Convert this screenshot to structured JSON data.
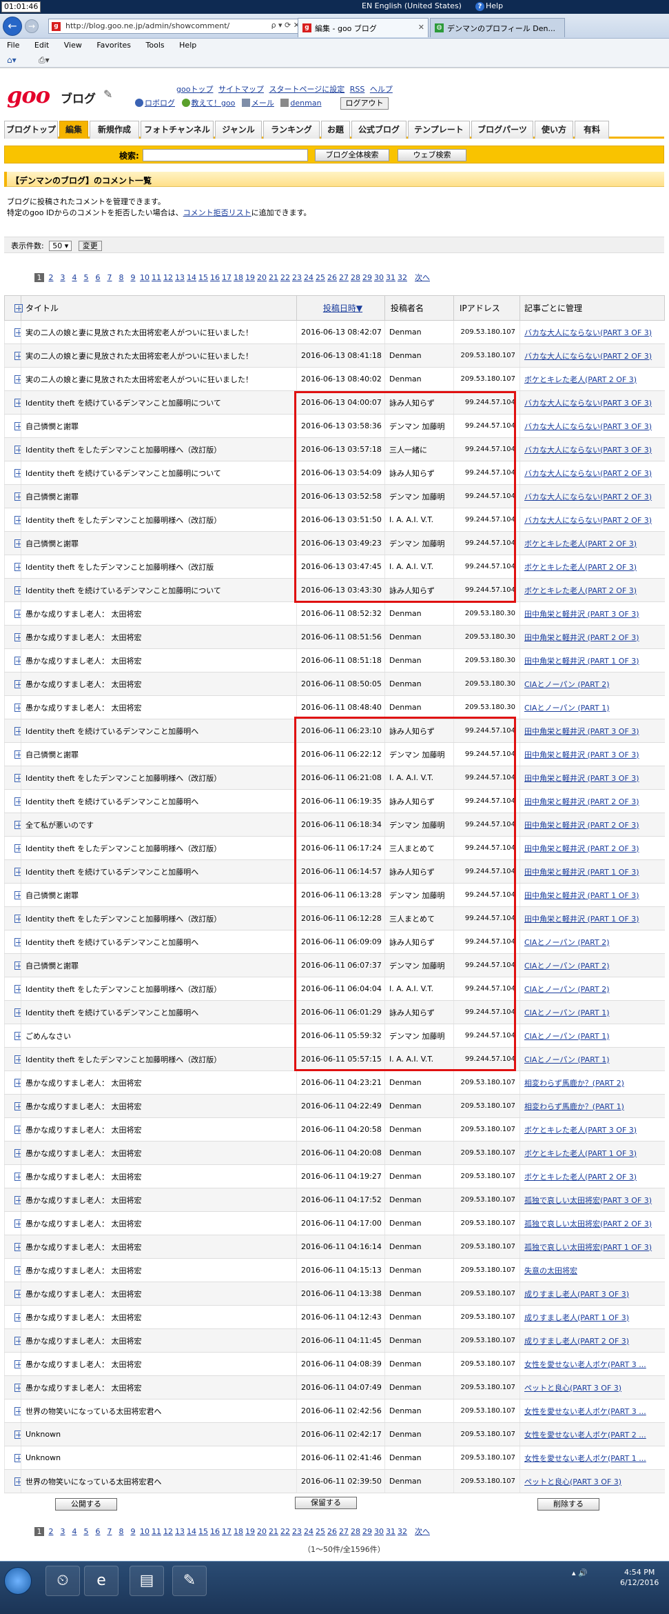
{
  "system": {
    "clock": "01:01:46",
    "language": "EN English (United States)",
    "help": "Help"
  },
  "browser": {
    "url": "http://blog.goo.ne.jp/admin/showcomment/",
    "address_tools": "ρ ▾ ⟳ ✕",
    "tabs": [
      "編集 - goo ブログ",
      "デンマンのプロフィール Den..."
    ],
    "menu": [
      "File",
      "Edit",
      "View",
      "Favorites",
      "Tools",
      "Help"
    ]
  },
  "site": {
    "logo": "goo",
    "blog_word": "ブログ",
    "top_links": [
      "gooトップ",
      "サイトマップ",
      "スタートページに設定",
      "RSS",
      "ヘルプ"
    ],
    "user_links": [
      "ロボログ",
      "教えて！goo",
      "メール",
      "denman"
    ],
    "logout": "ログアウト",
    "nav": [
      "ブログトップ",
      "編集",
      "新規作成",
      "フォトチャンネル",
      "ジャンル",
      "ランキング",
      "お題",
      "公式ブログ",
      "テンプレート",
      "ブログパーツ",
      "使い方",
      "有料"
    ],
    "search_label": "検索:",
    "search_blog_btn": "ブログ全体検索",
    "search_web_btn": "ウェブ検索"
  },
  "section": {
    "title": "【デンマンのブログ】のコメント一覧",
    "desc1": "ブログに投稿されたコメントを管理できます。",
    "desc2_prefix": "特定のgoo IDからのコメントを拒否したい場合は、",
    "desc2_link": "コメント拒否リスト",
    "desc2_suffix": "に追加できます。",
    "show_label": "表示件数:",
    "show_value": "50 ▾",
    "change_btn": "変更"
  },
  "pager": {
    "pages": [
      "1",
      "2",
      "3",
      "4",
      "5",
      "6",
      "7",
      "8",
      "9",
      "10",
      "11",
      "12",
      "13",
      "14",
      "15",
      "16",
      "17",
      "18",
      "19",
      "20",
      "21",
      "22",
      "23",
      "24",
      "25",
      "26",
      "27",
      "28",
      "29",
      "30",
      "31",
      "32"
    ],
    "next": "次へ"
  },
  "table": {
    "headers": {
      "title": "タイトル",
      "date": "投稿日時▼",
      "name": "投稿者名",
      "ip": "IPアドレス",
      "article": "記事ごとに管理"
    },
    "rows": [
      {
        "t": "実の二人の娘と妻に見放された太田将宏老人がついに狂いました！",
        "d": "2016-06-13 08:42:07",
        "n": "Denman",
        "ip": "209.53.180.107",
        "a": "バカな大人にならない(PART 3 OF 3)"
      },
      {
        "t": "実の二人の娘と妻に見放された太田将宏老人がついに狂いました！",
        "d": "2016-06-13 08:41:18",
        "n": "Denman",
        "ip": "209.53.180.107",
        "a": "バカな大人にならない(PART 2 OF 3)"
      },
      {
        "t": "実の二人の娘と妻に見放された太田将宏老人がついに狂いました！",
        "d": "2016-06-13 08:40:02",
        "n": "Denman",
        "ip": "209.53.180.107",
        "a": "ボケとキレた老人(PART 2 OF 3)"
      },
      {
        "t": "Identity theft を続けているデンマンこと加藤明について",
        "d": "2016-06-13 04:00:07",
        "n": "詠み人知らず",
        "ip": "99.244.57.104",
        "a": "バカな大人にならない(PART 3 OF 3)"
      },
      {
        "t": "自己憐憫と謝罪",
        "d": "2016-06-13 03:58:36",
        "n": "デンマン 加藤明",
        "ip": "99.244.57.104",
        "a": "バカな大人にならない(PART 3 OF 3)"
      },
      {
        "t": "Identity theft をしたデンマンこと加藤明様へ（改訂版）",
        "d": "2016-06-13 03:57:18",
        "n": "三人一緒に",
        "ip": "99.244.57.104",
        "a": "バカな大人にならない(PART 3 OF 3)"
      },
      {
        "t": "Identity theft を続けているデンマンこと加藤明について",
        "d": "2016-06-13 03:54:09",
        "n": "詠み人知らず",
        "ip": "99.244.57.104",
        "a": "バカな大人にならない(PART 2 OF 3)"
      },
      {
        "t": "自己憐憫と謝罪",
        "d": "2016-06-13 03:52:58",
        "n": "デンマン 加藤明",
        "ip": "99.244.57.104",
        "a": "バカな大人にならない(PART 2 OF 3)"
      },
      {
        "t": "Identity theft をしたデンマンこと加藤明様へ（改訂版）",
        "d": "2016-06-13 03:51:50",
        "n": "I. A. A.I. V.T.",
        "ip": "99.244.57.104",
        "a": "バカな大人にならない(PART 2 OF 3)"
      },
      {
        "t": "自己憐憫と謝罪",
        "d": "2016-06-13 03:49:23",
        "n": "デンマン 加藤明",
        "ip": "99.244.57.104",
        "a": "ボケとキレた老人(PART 2 OF 3)"
      },
      {
        "t": "Identity theft をしたデンマンこと加藤明様へ（改訂版",
        "d": "2016-06-13 03:47:45",
        "n": "I. A. A.I. V.T.",
        "ip": "99.244.57.104",
        "a": "ボケとキレた老人(PART 2 OF 3)"
      },
      {
        "t": "Identity theft を続けているデンマンこと加藤明について",
        "d": "2016-06-13 03:43:30",
        "n": "詠み人知らず",
        "ip": "99.244.57.104",
        "a": "ボケとキレた老人(PART 2 OF 3)"
      },
      {
        "t": "愚かな成りすまし老人： 太田将宏",
        "d": "2016-06-11 08:52:32",
        "n": "Denman",
        "ip": "209.53.180.30",
        "a": "田中角栄と軽井沢 (PART 3 OF 3)"
      },
      {
        "t": "愚かな成りすまし老人： 太田将宏",
        "d": "2016-06-11 08:51:56",
        "n": "Denman",
        "ip": "209.53.180.30",
        "a": "田中角栄と軽井沢 (PART 2 OF 3)"
      },
      {
        "t": "愚かな成りすまし老人： 太田将宏",
        "d": "2016-06-11 08:51:18",
        "n": "Denman",
        "ip": "209.53.180.30",
        "a": "田中角栄と軽井沢 (PART 1 OF 3)"
      },
      {
        "t": "愚かな成りすまし老人： 太田将宏",
        "d": "2016-06-11 08:50:05",
        "n": "Denman",
        "ip": "209.53.180.30",
        "a": "CIAとノーパン (PART 2)"
      },
      {
        "t": "愚かな成りすまし老人： 太田将宏",
        "d": "2016-06-11 08:48:40",
        "n": "Denman",
        "ip": "209.53.180.30",
        "a": "CIAとノーパン (PART 1)"
      },
      {
        "t": "Identity theft を続けているデンマンこと加藤明へ",
        "d": "2016-06-11 06:23:10",
        "n": "詠み人知らず",
        "ip": "99.244.57.104",
        "a": "田中角栄と軽井沢 (PART 3 OF 3)"
      },
      {
        "t": "自己憐憫と謝罪",
        "d": "2016-06-11 06:22:12",
        "n": "デンマン 加藤明",
        "ip": "99.244.57.104",
        "a": "田中角栄と軽井沢 (PART 3 OF 3)"
      },
      {
        "t": "Identity theft をしたデンマンこと加藤明様へ（改訂版）",
        "d": "2016-06-11 06:21:08",
        "n": "I. A. A.I. V.T.",
        "ip": "99.244.57.104",
        "a": "田中角栄と軽井沢 (PART 3 OF 3)"
      },
      {
        "t": "Identity theft を続けているデンマンこと加藤明へ",
        "d": "2016-06-11 06:19:35",
        "n": "詠み人知らず",
        "ip": "99.244.57.104",
        "a": "田中角栄と軽井沢 (PART 2 OF 3)"
      },
      {
        "t": "全て私が悪いのです",
        "d": "2016-06-11 06:18:34",
        "n": "デンマン 加藤明",
        "ip": "99.244.57.104",
        "a": "田中角栄と軽井沢 (PART 2 OF 3)"
      },
      {
        "t": "Identity theft をしたデンマンこと加藤明様へ（改訂版）",
        "d": "2016-06-11 06:17:24",
        "n": "三人まとめて",
        "ip": "99.244.57.104",
        "a": "田中角栄と軽井沢 (PART 2 OF 3)"
      },
      {
        "t": "Identity theft を続けているデンマンこと加藤明へ",
        "d": "2016-06-11 06:14:57",
        "n": "詠み人知らず",
        "ip": "99.244.57.104",
        "a": "田中角栄と軽井沢 (PART 1 OF 3)"
      },
      {
        "t": "自己憐憫と謝罪",
        "d": "2016-06-11 06:13:28",
        "n": "デンマン 加藤明",
        "ip": "99.244.57.104",
        "a": "田中角栄と軽井沢 (PART 1 OF 3)"
      },
      {
        "t": "Identity theft をしたデンマンこと加藤明様へ（改訂版）",
        "d": "2016-06-11 06:12:28",
        "n": "三人まとめて",
        "ip": "99.244.57.104",
        "a": "田中角栄と軽井沢 (PART 1 OF 3)"
      },
      {
        "t": "Identity theft を続けているデンマンこと加藤明へ",
        "d": "2016-06-11 06:09:09",
        "n": "詠み人知らず",
        "ip": "99.244.57.104",
        "a": "CIAとノーパン (PART 2)"
      },
      {
        "t": "自己憐憫と謝罪",
        "d": "2016-06-11 06:07:37",
        "n": "デンマン 加藤明",
        "ip": "99.244.57.104",
        "a": "CIAとノーパン (PART 2)"
      },
      {
        "t": "Identity theft をしたデンマンこと加藤明様へ（改訂版）",
        "d": "2016-06-11 06:04:04",
        "n": "I. A. A.I. V.T.",
        "ip": "99.244.57.104",
        "a": "CIAとノーパン (PART 2)"
      },
      {
        "t": "Identity theft を続けているデンマンこと加藤明へ",
        "d": "2016-06-11 06:01:29",
        "n": "詠み人知らず",
        "ip": "99.244.57.104",
        "a": "CIAとノーパン (PART 1)"
      },
      {
        "t": "ごめんなさい",
        "d": "2016-06-11 05:59:32",
        "n": "デンマン 加藤明",
        "ip": "99.244.57.104",
        "a": "CIAとノーパン (PART 1)"
      },
      {
        "t": "Identity theft をしたデンマンこと加藤明様へ（改訂版）",
        "d": "2016-06-11 05:57:15",
        "n": "I. A. A.I. V.T.",
        "ip": "99.244.57.104",
        "a": "CIAとノーパン (PART 1)"
      },
      {
        "t": "愚かな成りすまし老人： 太田将宏",
        "d": "2016-06-11 04:23:21",
        "n": "Denman",
        "ip": "209.53.180.107",
        "a": "相変わらず馬鹿か？(PART 2)"
      },
      {
        "t": "愚かな成りすまし老人： 太田将宏",
        "d": "2016-06-11 04:22:49",
        "n": "Denman",
        "ip": "209.53.180.107",
        "a": "相変わらず馬鹿か？(PART 1)"
      },
      {
        "t": "愚かな成りすまし老人： 太田将宏",
        "d": "2016-06-11 04:20:58",
        "n": "Denman",
        "ip": "209.53.180.107",
        "a": "ボケとキレた老人(PART 3 OF 3)"
      },
      {
        "t": "愚かな成りすまし老人： 太田将宏",
        "d": "2016-06-11 04:20:08",
        "n": "Denman",
        "ip": "209.53.180.107",
        "a": "ボケとキレた老人(PART 1 OF 3)"
      },
      {
        "t": "愚かな成りすまし老人： 太田将宏",
        "d": "2016-06-11 04:19:27",
        "n": "Denman",
        "ip": "209.53.180.107",
        "a": "ボケとキレた老人(PART 2 OF 3)"
      },
      {
        "t": "愚かな成りすまし老人： 太田将宏",
        "d": "2016-06-11 04:17:52",
        "n": "Denman",
        "ip": "209.53.180.107",
        "a": "孤独で哀しい太田将宏(PART 3 OF 3)"
      },
      {
        "t": "愚かな成りすまし老人： 太田将宏",
        "d": "2016-06-11 04:17:00",
        "n": "Denman",
        "ip": "209.53.180.107",
        "a": "孤独で哀しい太田将宏(PART 2 OF 3)"
      },
      {
        "t": "愚かな成りすまし老人： 太田将宏",
        "d": "2016-06-11 04:16:14",
        "n": "Denman",
        "ip": "209.53.180.107",
        "a": "孤独で哀しい太田将宏(PART 1 OF 3)"
      },
      {
        "t": "愚かな成りすまし老人： 太田将宏",
        "d": "2016-06-11 04:15:13",
        "n": "Denman",
        "ip": "209.53.180.107",
        "a": "失意の太田将宏"
      },
      {
        "t": "愚かな成りすまし老人： 太田将宏",
        "d": "2016-06-11 04:13:38",
        "n": "Denman",
        "ip": "209.53.180.107",
        "a": "成りすまし老人(PART 3 OF 3)"
      },
      {
        "t": "愚かな成りすまし老人： 太田将宏",
        "d": "2016-06-11 04:12:43",
        "n": "Denman",
        "ip": "209.53.180.107",
        "a": "成りすまし老人(PART 1 OF 3)"
      },
      {
        "t": "愚かな成りすまし老人： 太田将宏",
        "d": "2016-06-11 04:11:45",
        "n": "Denman",
        "ip": "209.53.180.107",
        "a": "成りすまし老人(PART 2 OF 3)"
      },
      {
        "t": "愚かな成りすまし老人： 太田将宏",
        "d": "2016-06-11 04:08:39",
        "n": "Denman",
        "ip": "209.53.180.107",
        "a": "女性を愛せない老人ボケ(PART 3 ..."
      },
      {
        "t": "愚かな成りすまし老人： 太田将宏",
        "d": "2016-06-11 04:07:49",
        "n": "Denman",
        "ip": "209.53.180.107",
        "a": "ペットと良心(PART 3 OF 3)"
      },
      {
        "t": "世界の物笑いになっている太田将宏君へ",
        "d": "2016-06-11 02:42:56",
        "n": "Denman",
        "ip": "209.53.180.107",
        "a": "女性を愛せない老人ボケ(PART 3 ..."
      },
      {
        "t": "Unknown",
        "d": "2016-06-11 02:42:17",
        "n": "Denman",
        "ip": "209.53.180.107",
        "a": "女性を愛せない老人ボケ(PART 2 ..."
      },
      {
        "t": "Unknown",
        "d": "2016-06-11 02:41:46",
        "n": "Denman",
        "ip": "209.53.180.107",
        "a": "女性を愛せない老人ボケ(PART 1 ..."
      },
      {
        "t": "世界の物笑いになっている太田将宏君へ",
        "d": "2016-06-11 02:39:50",
        "n": "Denman",
        "ip": "209.53.180.107",
        "a": "ペットと良心(PART 3 OF 3)"
      }
    ]
  },
  "actions": {
    "publish": "公開する",
    "hold": "保留する",
    "delete": "削除する"
  },
  "total": "（1〜50件/全1596件）",
  "taskbar": {
    "time": "4:54 PM",
    "date": "6/12/2016"
  }
}
